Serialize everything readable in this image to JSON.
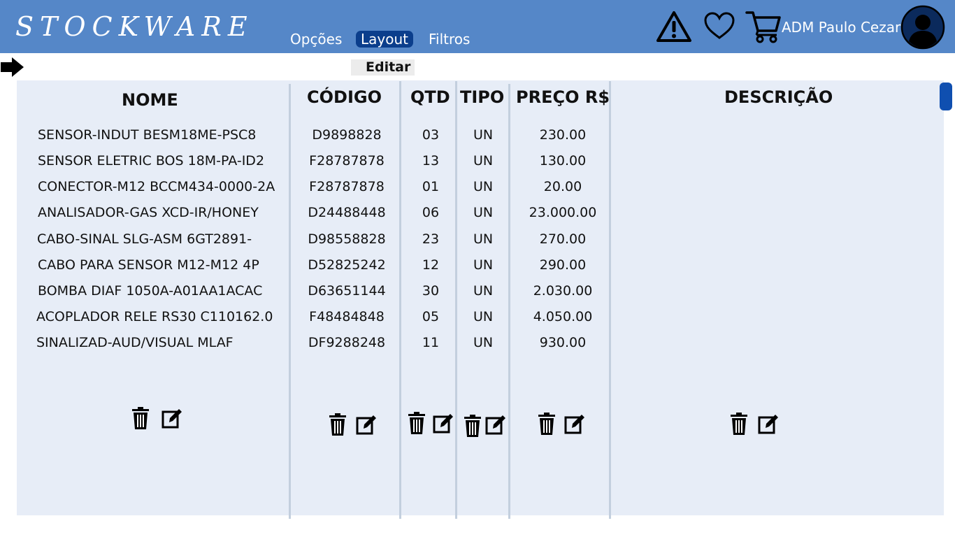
{
  "app": {
    "title": "STOCKWARE"
  },
  "nav": {
    "options": "Opções",
    "layout": "Layout",
    "filters": "Filtros"
  },
  "header": {
    "user_name": "ADM Paulo Cezar"
  },
  "toolbar": {
    "edit_label": "Editar"
  },
  "table": {
    "headers": {
      "name": "NOME",
      "code": "CÓDIGO",
      "qty": "QTD",
      "type": "TIPO",
      "price": "PREÇO R$",
      "description": "DESCRIÇÃO"
    },
    "rows": [
      {
        "name": "SENSOR-INDUT BESM18ME-PSC8",
        "code": "D9898828",
        "qty": "03",
        "type": "UN",
        "price": "230.00"
      },
      {
        "name": "SENSOR ELETRIC BOS 18M-PA-ID2",
        "code": "F28787878",
        "qty": "13",
        "type": "UN",
        "price": "130.00"
      },
      {
        "name": "CONECTOR-M12 BCCM434-0000-2A",
        "code": "F28787878",
        "qty": "01",
        "type": "UN",
        "price": "20.00"
      },
      {
        "name": "ANALISADOR-GAS XCD-IR/HONEY",
        "code": "D24488448",
        "qty": "06",
        "type": "UN",
        "price": "23.000.00"
      },
      {
        "name": "CABO-SINAL SLG-ASM 6GT2891-",
        "code": "D98558828",
        "qty": "23",
        "type": "UN",
        "price": "270.00"
      },
      {
        "name": "CABO PARA SENSOR M12-M12 4P",
        "code": "D52825242",
        "qty": "12",
        "type": "UN",
        "price": "290.00"
      },
      {
        "name": "BOMBA DIAF 1050A-A01AA1ACAC",
        "code": "D63651144",
        "qty": "30",
        "type": "UN",
        "price": "2.030.00"
      },
      {
        "name": "ACOPLADOR RELE RS30 C110162.0",
        "code": "F48484848",
        "qty": "05",
        "type": "UN",
        "price": "4.050.00"
      },
      {
        "name": "SINALIZAD-AUD/VISUAL MLAF",
        "code": "DF9288248",
        "qty": "11",
        "type": "UN",
        "price": "930.00"
      }
    ]
  },
  "icons": {
    "alert": "warning-triangle-icon",
    "favorites": "heart-icon",
    "cart": "shopping-cart-icon",
    "avatar": "user-avatar-icon",
    "arrow": "arrow-right-icon",
    "delete": "trash-icon",
    "edit": "edit-pencil-icon"
  },
  "colors": {
    "header_bg": "#5587c8",
    "active_tab": "#0b3e8c",
    "panel_bg": "#e7edf7",
    "scroll_thumb": "#0f4fb0"
  }
}
